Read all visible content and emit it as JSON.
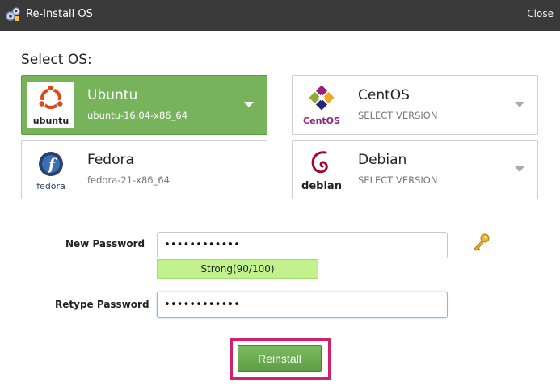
{
  "window": {
    "title": "Re-Install OS",
    "close_label": "Close",
    "icon": "gears-icon"
  },
  "select_os_label": "Select OS:",
  "os_options": [
    {
      "name": "Ubuntu",
      "version": "ubuntu-16.04-x86_64",
      "logo_text": "ubuntu",
      "selected": true,
      "has_dropdown": true
    },
    {
      "name": "CentOS",
      "version": "SELECT VERSION",
      "logo_text": "CentOS",
      "selected": false,
      "has_dropdown": true
    },
    {
      "name": "Fedora",
      "version": "fedora-21-x86_64",
      "logo_text": "fedora",
      "selected": false,
      "has_dropdown": false
    },
    {
      "name": "Debian",
      "version": "SELECT VERSION",
      "logo_text": "debian",
      "selected": false,
      "has_dropdown": true
    }
  ],
  "password": {
    "new_label": "New Password",
    "new_value": "••••••••••••",
    "strength": "Strong(90/100)",
    "retype_label": "Retype Password",
    "retype_value": "••••••••••••",
    "generate_icon": "key-icon"
  },
  "reinstall_label": "Reinstall",
  "colors": {
    "titlebar": "#3a3a3a",
    "selected_card": "#76b35a",
    "strength_bar": "#c1f28c",
    "highlight": "#d4206a",
    "ubuntu": "#dd4814",
    "fedora": "#294172",
    "debian": "#a80030",
    "centos_purple": "#932279",
    "centos_green": "#8fa93d",
    "centos_blue": "#262577",
    "centos_orange": "#efa724"
  }
}
